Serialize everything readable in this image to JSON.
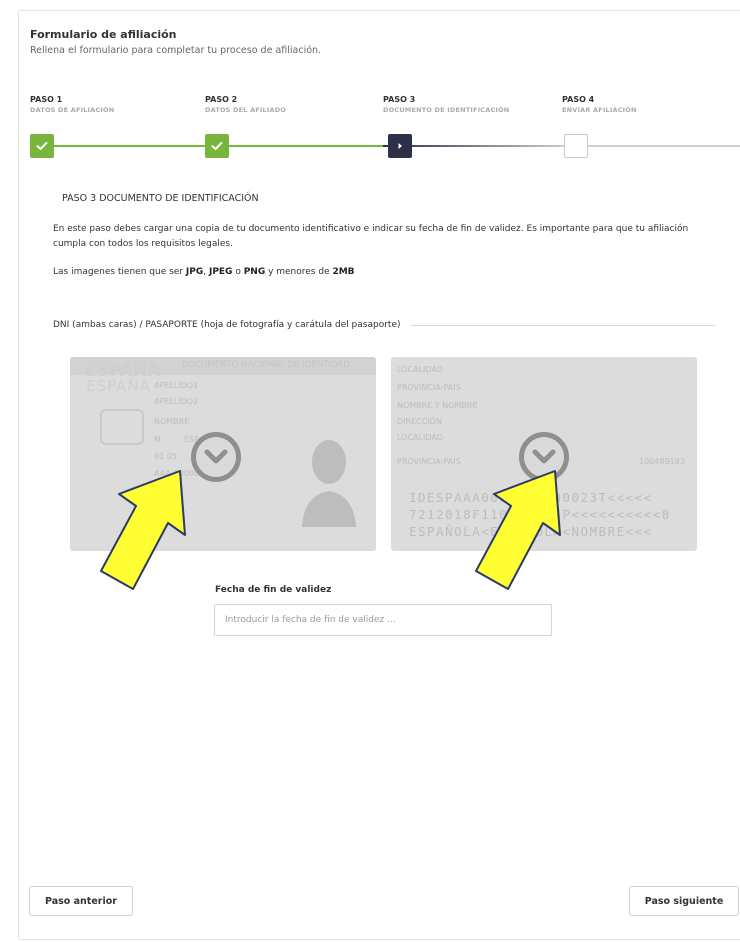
{
  "header": {
    "title": "Formulario de afiliación",
    "subtitle": "Rellena el formulario para completar tu proceso de afiliación."
  },
  "steps": [
    {
      "num": "PASO 1",
      "label": "DATOS DE AFILIACIÓN",
      "state": "done"
    },
    {
      "num": "PASO 2",
      "label": "DATOS DEL AFILIADO",
      "state": "done"
    },
    {
      "num": "PASO 3",
      "label": "DOCUMENTO DE IDENTIFICACIÓN",
      "state": "current"
    },
    {
      "num": "PASO 4",
      "label": "ENVIAR AFILIACIÓN",
      "state": "pending"
    }
  ],
  "section": {
    "title": "PASO 3 DOCUMENTO DE IDENTIFICACIÓN",
    "description": "En este paso debes cargar una copia de tu documento identificativo e indicar su fecha de fin de validez. Es importante para que tu afiliación cumpla con todos los requisitos legales.",
    "formats_prefix": "Las imagenes tienen que ser ",
    "fmt_jpg": "JPG",
    "fmt_sep1": ", ",
    "fmt_jpeg": "JPEG",
    "fmt_sep2": " o ",
    "fmt_png": "PNG",
    "fmt_mid": " y menores de ",
    "fmt_size": "2MB"
  },
  "documents": {
    "legend": "DNI (ambas caras) / PASAPORTE (hoja de fotografía y carátula del pasaporte)",
    "front": {
      "header": "DOCUMENTO NACIONAL DE IDENTIDAD",
      "country": "ESPAÑA",
      "apellido1": "APELLIDO1",
      "apellido2": "APELLIDO2",
      "nombre": "NOMBRE",
      "sexo": "M",
      "nacionalidad": "ESP",
      "fecha": "01  05",
      "docnum": "AAA-00000",
      "year": "20"
    },
    "back": {
      "lugar_nac": "LOCALIDAD",
      "provincia": "PROVINCIA-PAIS",
      "padres": "NOMBRE Y NOMBRE",
      "domicilio": "DIRECCIÓN",
      "localidad": "LOCALIDAD",
      "provincia2": "PROVINCIA-PAIS",
      "equipo": "100489183",
      "mrz1": "IDESPAAA0000000000023T<<<<<",
      "mrz2": "7212018F1101018ESP<<<<<<<<<<8",
      "mrz3": "ESPAÑOLA<ESPAÑOLA<NOMBRE<<<"
    }
  },
  "validity": {
    "label": "Fecha de fin de validez",
    "placeholder": "Introducir la fecha de fin de validez ...",
    "value": ""
  },
  "nav": {
    "prev_label": "Paso anterior",
    "next_label": "Paso siguiente"
  },
  "colors": {
    "done": "#78b53c",
    "current": "#2c3147",
    "arrow_fill": "#ffff33",
    "arrow_stroke": "#2d3a66"
  }
}
